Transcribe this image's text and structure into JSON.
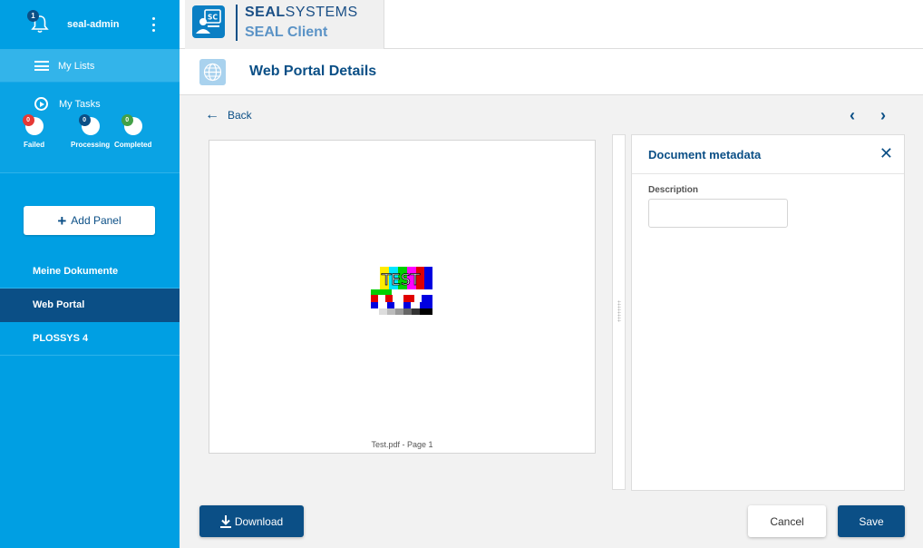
{
  "sidebar": {
    "user": {
      "name": "seal-admin",
      "notifications": "1"
    },
    "my_lists": "My Lists",
    "my_tasks": {
      "title": "My Tasks",
      "stats": [
        {
          "label": "Failed",
          "count": "0",
          "color": "#e53935"
        },
        {
          "label": "Processing",
          "count": "0",
          "color": "#0b4f86"
        },
        {
          "label": "Completed",
          "count": "0",
          "color": "#43a047"
        }
      ]
    },
    "add_panel": "Add Panel",
    "panels": [
      {
        "label": "Meine Dokumente",
        "active": false
      },
      {
        "label": "Web Portal",
        "active": true
      },
      {
        "label": "PLOSSYS 4",
        "active": false
      }
    ]
  },
  "header": {
    "brand_bold": "SEAL",
    "brand_rest": "SYSTEMS",
    "product": "SEAL Client",
    "logo_text": "SC"
  },
  "page": {
    "title": "Web Portal Details"
  },
  "content": {
    "back": "Back",
    "preview": {
      "image_text": "TEST",
      "caption": "Test.pdf - Page 1"
    },
    "metadata": {
      "title": "Document metadata",
      "description_label": "Description",
      "description_value": ""
    },
    "buttons": {
      "download": "Download",
      "cancel": "Cancel",
      "save": "Save"
    }
  },
  "colors": {
    "sidebar": "#009fe3",
    "active": "#0b4f86",
    "accent": "#0b4f86"
  }
}
